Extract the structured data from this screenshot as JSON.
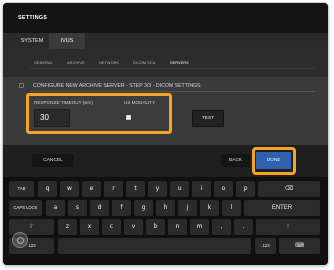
{
  "window": {
    "title": "SETTINGS"
  },
  "tabs": [
    {
      "label": "SYSTEM"
    },
    {
      "label": "IVUS"
    }
  ],
  "subtabs": [
    {
      "label": "GENERAL"
    },
    {
      "label": "ARCHIVE"
    },
    {
      "label": "NETWORK"
    },
    {
      "label": "DICOM SCU"
    },
    {
      "label": "SERVERS"
    }
  ],
  "step": {
    "title": "CONFIGURE NEW ARCHIVE SERVER - STEP 3/3 - DICOM SETTINGS"
  },
  "form": {
    "response_timeout_label": "RESPONSE TIMEOUT (sec)",
    "response_timeout_value": "30",
    "us_modality_label": "US MODALITY",
    "test_label": "TEST"
  },
  "footer": {
    "cancel_label": "CANCEL",
    "back_label": "BACK",
    "done_label": "DONE"
  },
  "keyboard": {
    "row1": [
      "TAB",
      "q",
      "w",
      "e",
      "r",
      "t",
      "y",
      "u",
      "i",
      "o",
      "p",
      "⌫"
    ],
    "row2": [
      "CAPS LOCK",
      "a",
      "s",
      "d",
      "f",
      "g",
      "h",
      "j",
      "k",
      "l",
      "ENTER"
    ],
    "row3": [
      "⇧",
      "z",
      "x",
      "c",
      "v",
      "b",
      "n",
      "m",
      ",",
      ".",
      "⇧"
    ],
    "row4": [
      ".123",
      "",
      ".123",
      "⌨"
    ]
  },
  "colors": {
    "accent_highlight": "#f5a523",
    "done_button": "#2f5fb0"
  }
}
